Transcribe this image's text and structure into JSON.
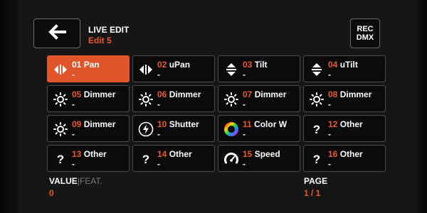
{
  "header": {
    "title": "LIVE EDIT",
    "subtitle": "Edit 5",
    "rec_line1": "REC",
    "rec_line2": "DMX"
  },
  "cells": [
    {
      "num": "01",
      "name": "Pan",
      "value": "-",
      "icon": "pan-icon",
      "active": true
    },
    {
      "num": "02",
      "name": "uPan",
      "value": "-",
      "icon": "pan-icon"
    },
    {
      "num": "03",
      "name": "Tilt",
      "value": "-",
      "icon": "tilt-icon"
    },
    {
      "num": "04",
      "name": "uTilt",
      "value": "-",
      "icon": "tilt-icon"
    },
    {
      "num": "05",
      "name": "Dimmer",
      "value": "-",
      "icon": "sun-icon"
    },
    {
      "num": "06",
      "name": "Dimmer",
      "value": "-",
      "icon": "sun-icon"
    },
    {
      "num": "07",
      "name": "Dimmer",
      "value": "-",
      "icon": "sun-icon"
    },
    {
      "num": "08",
      "name": "Dimmer",
      "value": "-",
      "icon": "sun-icon"
    },
    {
      "num": "09",
      "name": "Dimmer",
      "value": "-",
      "icon": "sun-icon"
    },
    {
      "num": "10",
      "name": "Shutter",
      "value": "-",
      "icon": "lightning-icon"
    },
    {
      "num": "11",
      "name": "Color W",
      "value": "-",
      "icon": "color-wheel-icon"
    },
    {
      "num": "12",
      "name": "Other",
      "value": "-",
      "icon": "question-icon"
    },
    {
      "num": "13",
      "name": "Other",
      "value": "-",
      "icon": "question-icon"
    },
    {
      "num": "14",
      "name": "Other",
      "value": "-",
      "icon": "question-icon"
    },
    {
      "num": "15",
      "name": "Speed",
      "value": "-",
      "icon": "speed-gauge-icon"
    },
    {
      "num": "16",
      "name": "Other",
      "value": "-",
      "icon": "question-icon"
    }
  ],
  "footer": {
    "value_label": "VALUE",
    "separator": "|",
    "feat_label": "FEAT.",
    "value": "0",
    "page_label": "PAGE",
    "page_value": "1 / 1"
  },
  "colors": {
    "accent": "#e85a2a",
    "background": "#161616"
  }
}
